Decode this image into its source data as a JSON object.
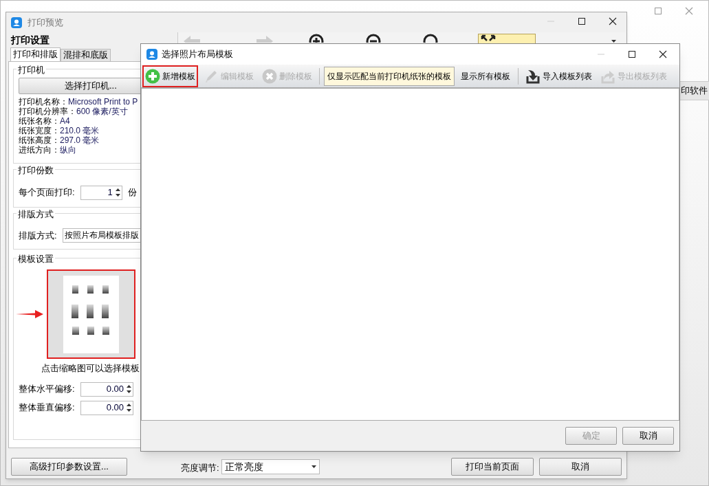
{
  "main_window": {
    "side_text": "印软件"
  },
  "preview_window": {
    "title": "打印预览",
    "settings_title": "打印设置",
    "tabs": [
      {
        "label": "打印和排版",
        "selected": true
      },
      {
        "label": "混排和底版",
        "selected": false
      }
    ],
    "printer_group": {
      "title": "打印机",
      "select_button": "选择打印机...",
      "info": [
        {
          "label": "打印机名称：",
          "value": "Microsoft Print to P"
        },
        {
          "label": "打印机分辨率：",
          "value": "600 像素/英寸"
        },
        {
          "label": "纸张名称：",
          "value": "A4"
        },
        {
          "label": "纸张宽度：",
          "value": "210.0 毫米"
        },
        {
          "label": "纸张高度：",
          "value": "297.0 毫米"
        },
        {
          "label": "进纸方向：",
          "value": "纵向"
        }
      ]
    },
    "copies_group": {
      "title": "打印份数",
      "label": "每个页面打印:",
      "value": "1",
      "unit": "份"
    },
    "layout_group": {
      "title": "排版方式",
      "label": "排版方式:",
      "value": "按照片布局模板排版"
    },
    "template_group": {
      "title": "模板设置",
      "caption": "点击缩略图可以选择模板",
      "offsets": [
        {
          "label": "整体水平偏移:",
          "value": "0.00"
        },
        {
          "label": "整体垂直偏移:",
          "value": "0.00"
        }
      ]
    },
    "toolbar": [
      {
        "kind": "prev",
        "selected": false
      },
      {
        "kind": "next",
        "selected": false
      },
      {
        "kind": "zoom_in",
        "selected": false
      },
      {
        "kind": "zoom_out",
        "selected": false
      },
      {
        "kind": "actual",
        "selected": false
      },
      {
        "kind": "fit",
        "selected": true
      },
      {
        "kind": "dropdown",
        "selected": false
      }
    ],
    "bottom": {
      "advanced_button": "高级打印参数设置...",
      "brightness_label": "亮度调节:",
      "brightness_value": "正常亮度",
      "print_button": "打印当前页面",
      "cancel_button": "取消"
    }
  },
  "dialog": {
    "title": "选择照片布局模板",
    "toolbar": [
      {
        "kind": "add",
        "label": "新增模板",
        "disabled": false,
        "highlighted": true
      },
      {
        "kind": "edit",
        "label": "编辑模板",
        "disabled": true,
        "highlighted": false
      },
      {
        "kind": "delete",
        "label": "删除模板",
        "disabled": true,
        "highlighted": false
      },
      {
        "kind": "separator"
      },
      {
        "kind": "filter",
        "label": "仅显示匹配当前打印机纸张的模板",
        "selected": true
      },
      {
        "kind": "filter",
        "label": "显示所有模板",
        "selected": false
      },
      {
        "kind": "separator"
      },
      {
        "kind": "import",
        "label": "导入模板列表",
        "disabled": false,
        "highlighted": false
      },
      {
        "kind": "export",
        "label": "导出模板列表",
        "disabled": true,
        "highlighted": false
      }
    ],
    "buttons": [
      {
        "label": "确定",
        "disabled": true
      },
      {
        "label": "取消",
        "disabled": false
      }
    ]
  }
}
